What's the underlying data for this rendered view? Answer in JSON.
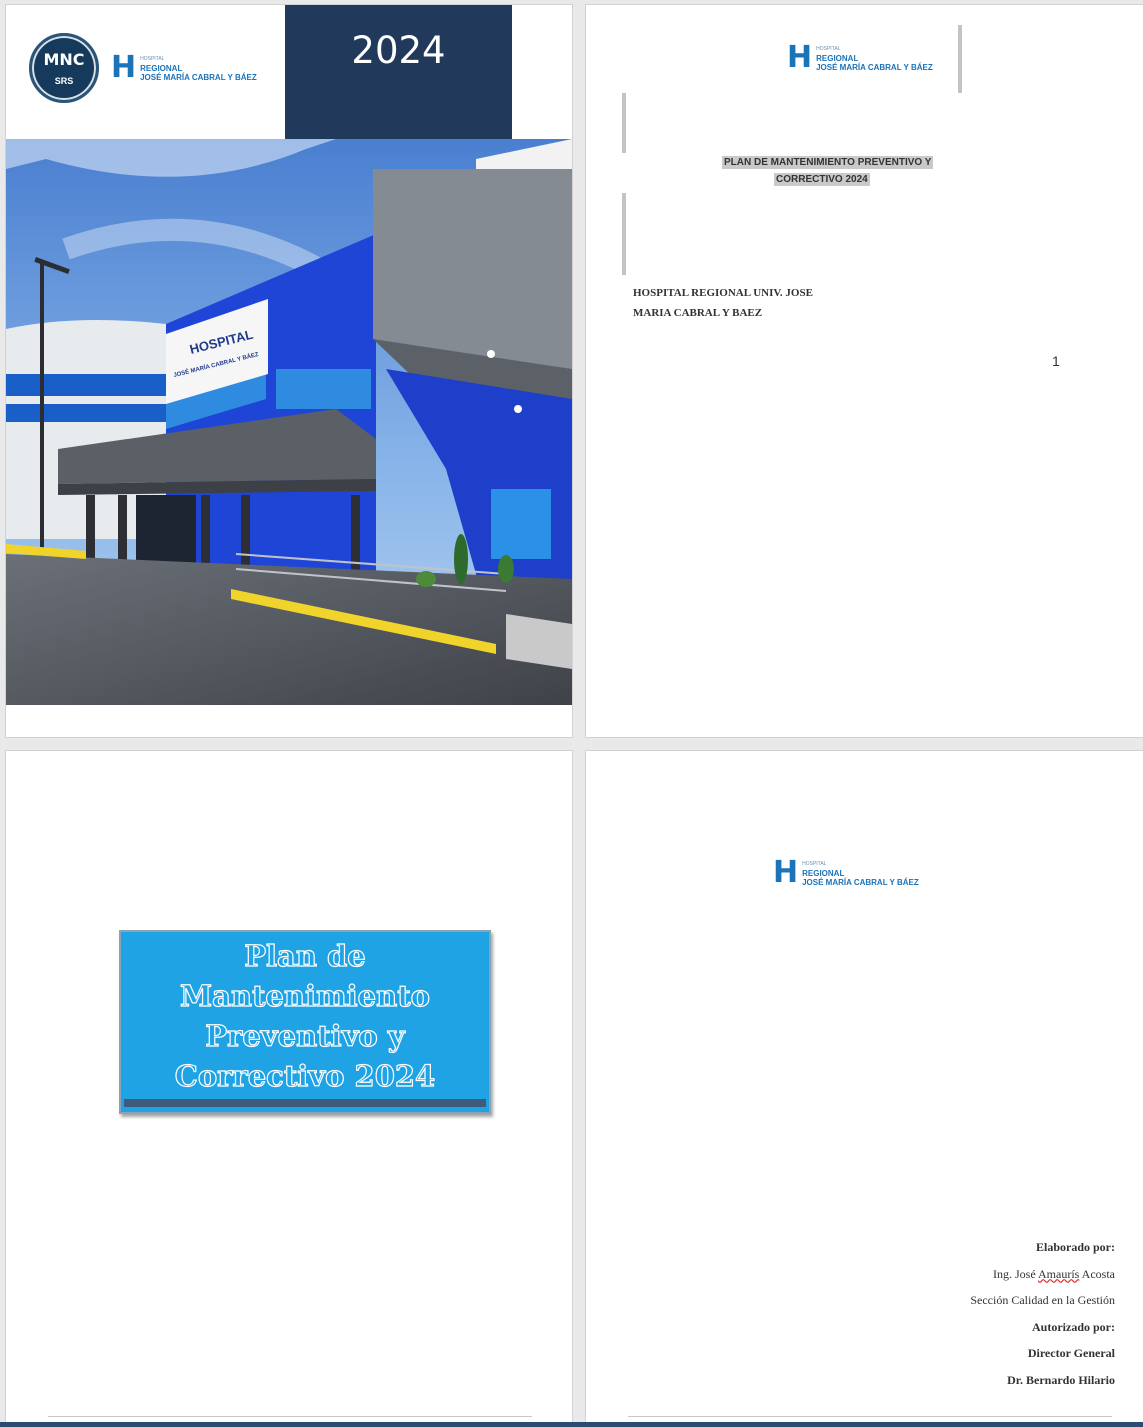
{
  "cover": {
    "year": "2024",
    "seal": {
      "mnc": "MNC",
      "srs": "SRS"
    },
    "logo": {
      "small": "HOSPITAL",
      "regional": "REGIONAL",
      "name": "JOSÉ MARÍA CABRAL Y BÁEZ"
    },
    "building_sign": {
      "line1": "HOSPITAL",
      "line2": "JOSÉ MARÍA CABRAL Y BÁEZ"
    }
  },
  "title_page": {
    "logo": {
      "small": "HOSPITAL",
      "regional": "REGIONAL",
      "name": "JOSÉ MARÍA CABRAL Y BÁEZ"
    },
    "title_line1": "PLAN DE MANTENIMIENTO PREVENTIVO Y",
    "title_line2": "CORRECTIVO 2024",
    "hospital_line1": "HOSPITAL REGIONAL UNIV. JOSE",
    "hospital_line2": "MARIA CABRAL Y BAEZ",
    "page_number": "1"
  },
  "plan_page": {
    "title_lines": [
      "Plan de",
      "Mantenimiento",
      "Preventivo y",
      "Correctivo 2024"
    ]
  },
  "credits_page": {
    "logo": {
      "small": "HOSPITAL",
      "regional": "REGIONAL",
      "name": "JOSÉ MARÍA CABRAL Y BÁEZ"
    },
    "elaborado_label": "Elaborado por:",
    "author_prefix": "Ing. José ",
    "author_middle": "Amaurís",
    "author_suffix": " Acosta",
    "section": "Sección Calidad en la Gestión",
    "autorizado_label": "Autorizado por:",
    "director_title": "Director General",
    "director_name": "Dr. Bernardo Hilario"
  },
  "colors": {
    "navy": "#213a5c",
    "brand_blue": "#1b73b8",
    "title_cyan": "#1fa3e4"
  }
}
